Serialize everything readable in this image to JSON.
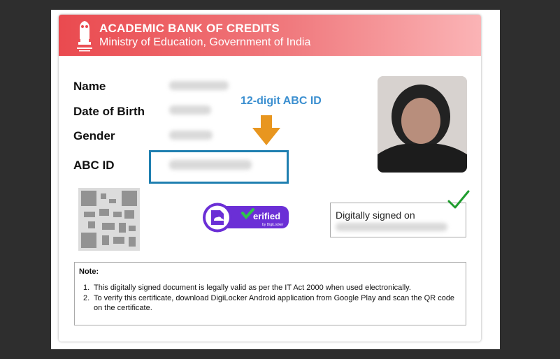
{
  "header": {
    "title": "ACADEMIC BANK OF CREDITS",
    "subtitle": "Ministry of Education, Government of India"
  },
  "fields": {
    "name_label": "Name",
    "dob_label": "Date of Birth",
    "gender_label": "Gender",
    "abc_label": "ABC ID"
  },
  "annotation": {
    "callout": "12-digit ABC ID",
    "arrow_color": "#e8961f",
    "box_color": "#1f7fb0"
  },
  "badge": {
    "icon": "digilocker-document-icon",
    "text": "erified",
    "subtext": "by DigiLocker"
  },
  "signature": {
    "label": "Digitally signed on"
  },
  "note": {
    "title": "Note:",
    "items": [
      {
        "num": "1.",
        "text": "This digitally signed document is legally valid as per the IT Act 2000 when used electronically."
      },
      {
        "num": "2.",
        "text": "To verify this certificate, download DigiLocker Android application from Google Play and scan the QR code on the certificate."
      }
    ]
  },
  "colors": {
    "header_start": "#ea4a4f",
    "header_end": "#fbb4b6",
    "callout_text": "#3b8fd0",
    "badge_purple": "#6b2fd6",
    "check_green": "#1f9d2e"
  }
}
